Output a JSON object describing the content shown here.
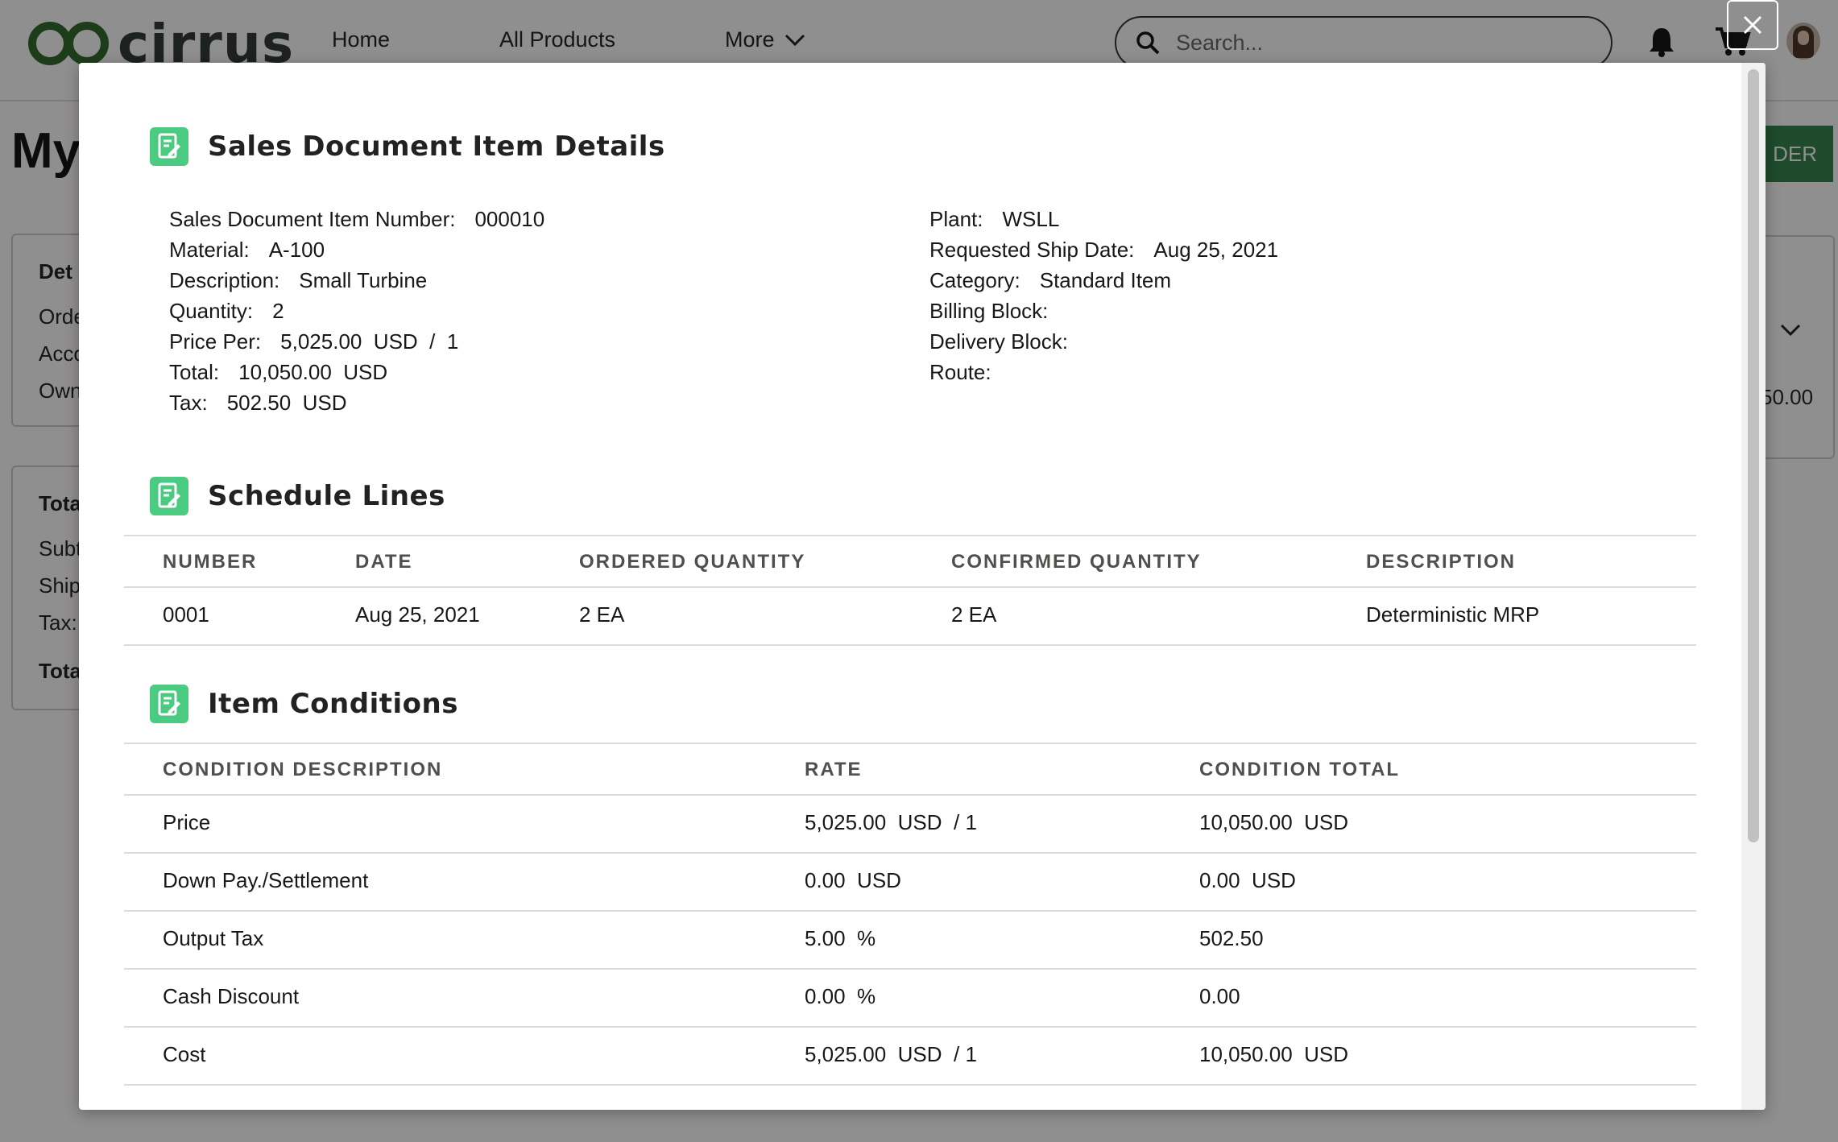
{
  "app": {
    "logo_text": "cirrus",
    "nav": {
      "home": "Home",
      "all_products": "All Products",
      "more": "More"
    },
    "search_placeholder": "Search..."
  },
  "background": {
    "page_title": "My",
    "card1": {
      "heading": "Det",
      "line1": "Orde",
      "line2": "Acco",
      "line3": "Own"
    },
    "card2": {
      "heading": "Tota",
      "line1": "Subt",
      "line2": "Ship",
      "line3": "Tax:",
      "line4": "Tota"
    },
    "order_button": "DER",
    "amount": "50.00"
  },
  "modal": {
    "item_details": {
      "title": "Sales Document Item Details",
      "left": [
        {
          "label": "Sales Document Item Number:",
          "value": "000010"
        },
        {
          "label": "Material:",
          "value": "A-100"
        },
        {
          "label": "Description:",
          "value": "Small Turbine"
        },
        {
          "label": "Quantity:",
          "value": "2"
        },
        {
          "label": "Price Per:",
          "value": "5,025.00  USD  /  1"
        },
        {
          "label": "Total:",
          "value": "10,050.00  USD"
        },
        {
          "label": "Tax:",
          "value": "502.50  USD"
        }
      ],
      "right": [
        {
          "label": "Plant:",
          "value": "WSLL"
        },
        {
          "label": "Requested Ship Date:",
          "value": "Aug 25, 2021"
        },
        {
          "label": "Category:",
          "value": "Standard Item"
        },
        {
          "label": "Billing Block:",
          "value": ""
        },
        {
          "label": "Delivery Block:",
          "value": ""
        },
        {
          "label": "Route:",
          "value": ""
        }
      ]
    },
    "schedule_lines": {
      "title": "Schedule Lines",
      "columns": [
        "NUMBER",
        "DATE",
        "ORDERED QUANTITY",
        "CONFIRMED QUANTITY",
        "DESCRIPTION"
      ],
      "rows": [
        [
          "0001",
          "Aug 25, 2021",
          "2 EA",
          "2 EA",
          "Deterministic MRP"
        ]
      ]
    },
    "item_conditions": {
      "title": "Item Conditions",
      "columns": [
        "CONDITION DESCRIPTION",
        "RATE",
        "CONDITION TOTAL"
      ],
      "rows": [
        [
          "Price",
          "5,025.00  USD  / 1",
          "10,050.00  USD"
        ],
        [
          "Down Pay./Settlement",
          "0.00  USD",
          "0.00  USD"
        ],
        [
          "Output Tax",
          "5.00  %",
          "502.50"
        ],
        [
          "Cash Discount",
          "0.00  %",
          "0.00"
        ],
        [
          "Cost",
          "5,025.00  USD  / 1",
          "10,050.00  USD"
        ]
      ]
    }
  }
}
